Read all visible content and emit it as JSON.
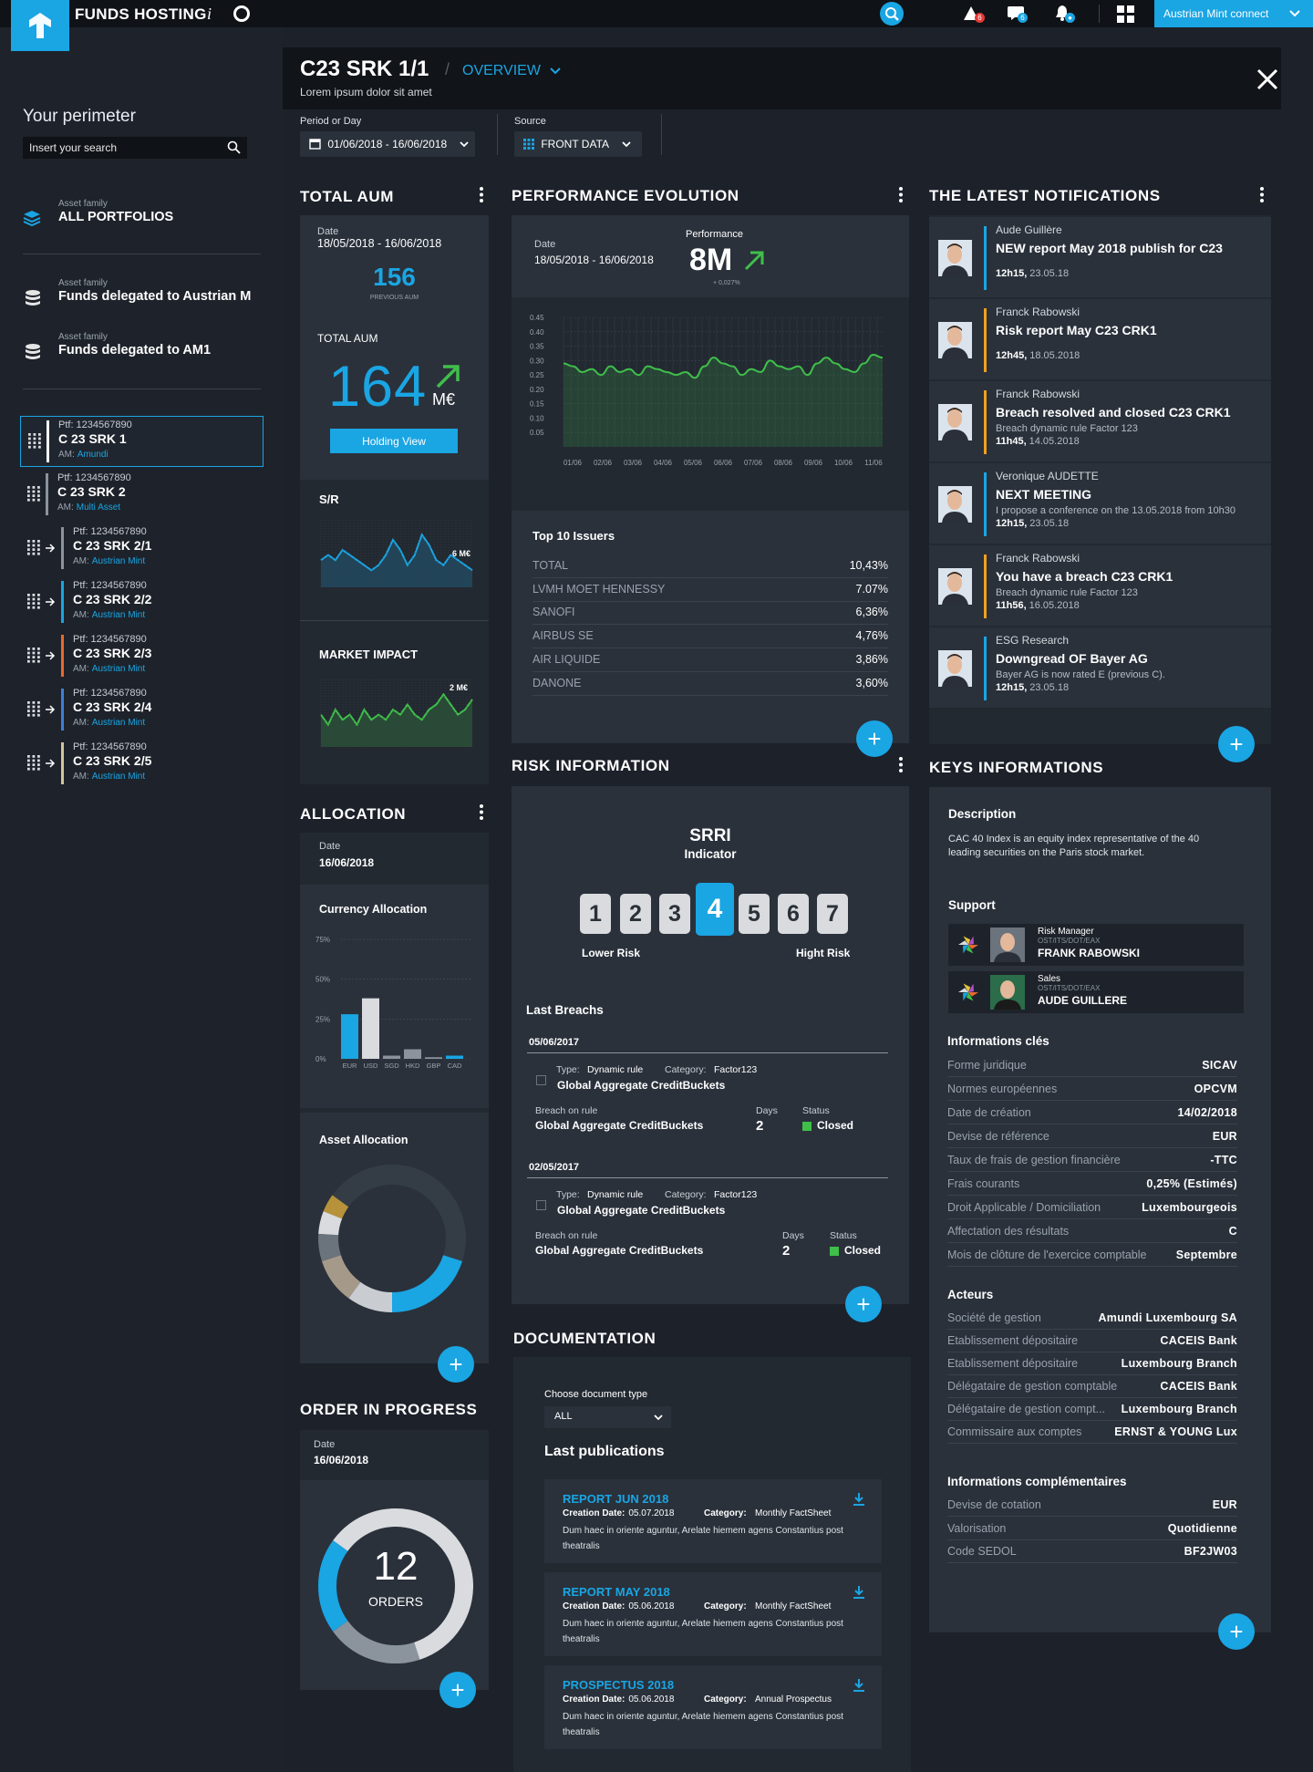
{
  "app": {
    "brand": "FUNDS HOSTING",
    "info": "i",
    "connect": "Austrian Mint connect",
    "alerts": {
      "warnings": "6",
      "messages": "6",
      "notifications": "●"
    }
  },
  "sidebar": {
    "title": "Your perimeter",
    "search_placeholder": "Insert your search",
    "families": [
      {
        "label": "Asset family",
        "value": "ALL PORTFOLIOS"
      },
      {
        "label": "Asset family",
        "value": "Funds delegated to Austrian M"
      },
      {
        "label": "Asset family",
        "value": "Funds delegated to AM1"
      }
    ],
    "portfolios": [
      {
        "ptf": "Ptf:  1234567890",
        "name": "C 23 SRK 1",
        "am_label": "AM:",
        "am": "Amundi",
        "color": "#ffffff"
      },
      {
        "ptf": "Ptf:  1234567890",
        "name": "C 23 SRK 2",
        "am_label": "AM:",
        "am": "Multi Asset",
        "color": "#8b939c"
      },
      {
        "ptf": "Ptf:  1234567890",
        "name": "C 23 SRK 2/1",
        "am_label": "AM:",
        "am": "Austrian Mint",
        "color": "#8b939c"
      },
      {
        "ptf": "Ptf:  1234567890",
        "name": "C 23 SRK 2/2",
        "am_label": "AM:",
        "am": "Austrian Mint",
        "color": "#1aa5e3"
      },
      {
        "ptf": "Ptf:  1234567890",
        "name": "C 23 SRK 2/3",
        "am_label": "AM:",
        "am": "Austrian Mint",
        "color": "#e8692c"
      },
      {
        "ptf": "Ptf:  1234567890",
        "name": "C 23 SRK 2/4",
        "am_label": "AM:",
        "am": "Austrian Mint",
        "color": "#3d7fd9"
      },
      {
        "ptf": "Ptf:  1234567890",
        "name": "C 23 SRK 2/5",
        "am_label": "AM:",
        "am": "Austrian Mint",
        "color": "#d6c49a"
      }
    ]
  },
  "header": {
    "title": "C23 SRK 1/1",
    "sep": "/",
    "view": "OVERVIEW",
    "subtitle": "Lorem ipsum dolor sit amet"
  },
  "filters": {
    "period_label": "Period or Day",
    "period": "01/06/2018 - 16/06/2018",
    "source_label": "Source",
    "source": "FRONT DATA"
  },
  "total_aum": {
    "title": "TOTAL AUM",
    "date_label": "Date",
    "date": "18/05/2018 - 16/06/2018",
    "previous": "156",
    "previous_label": "PREVIOUS AUM",
    "label": "TOTAL  AUM",
    "value": "164",
    "unit": "M€",
    "button": "Holding View",
    "sr_label": "S/R",
    "sr_value": "6 M€",
    "mi_label": "MARKET IMPACT",
    "mi_value": "2 M€"
  },
  "allocation": {
    "title": "ALLOCATION",
    "date_label": "Date",
    "date": "16/06/2018",
    "currency_title": "Currency Allocation",
    "asset_title": "Asset Allocation"
  },
  "orders": {
    "title": "ORDER IN PROGRESS",
    "date_label": "Date",
    "date": "16/06/2018",
    "count": "12",
    "count_label": "ORDERS"
  },
  "performance": {
    "title": "PERFORMANCE EVOLUTION",
    "date_label": "Date",
    "date": "18/05/2018 - 16/06/2018",
    "perf_label": "Performance",
    "value": "8M",
    "delta": "+ 0,027%",
    "issuers_title": "Top 10 Issuers",
    "issuers": [
      {
        "name": "TOTAL",
        "value": "10,43%"
      },
      {
        "name": "LVMH MOET HENNESSY",
        "value": "7.07%"
      },
      {
        "name": "SANOFI",
        "value": "6,36%"
      },
      {
        "name": "AIRBUS SE",
        "value": "4,76%"
      },
      {
        "name": "AIR LIQUIDE",
        "value": "3,86%"
      },
      {
        "name": "DANONE",
        "value": "3,60%"
      }
    ]
  },
  "risk": {
    "title": "RISK INFORMATION",
    "srri_title": "SRRI",
    "srri_sub": "Indicator",
    "levels": [
      "1",
      "2",
      "3",
      "4",
      "5",
      "6",
      "7"
    ],
    "current": 4,
    "low": "Lower Risk",
    "high": "Hight Risk",
    "breaches_title": "Last Breachs",
    "breaches": [
      {
        "date": "05/06/2017",
        "type_label": "Type:",
        "type": "Dynamic rule",
        "cat_label": "Category:",
        "cat": "Factor123",
        "name": "Global Aggregate CreditBuckets",
        "rule_label": "Breach on rule",
        "rule": "Global Aggregate CreditBuckets",
        "days_label": "Days",
        "days": "2",
        "status_label": "Status",
        "status": "Closed"
      },
      {
        "date": "02/05/2017",
        "type_label": "Type:",
        "type": "Dynamic rule",
        "cat_label": "Category:",
        "cat": "Factor123",
        "name": "Global Aggregate CreditBuckets",
        "rule_label": "Breach on rule",
        "rule": "Global Aggregate CreditBuckets",
        "days_label": "Days",
        "days": "2",
        "status_label": "Status",
        "status": "Closed"
      }
    ]
  },
  "documentation": {
    "title": "DOCUMENTATION",
    "choose_label": "Choose document type",
    "choose_value": "ALL",
    "last_title": "Last publications",
    "docs": [
      {
        "title": "REPORT JUN 2018",
        "date_label": "Creation Date:",
        "date": "05.07.2018",
        "cat_label": "Category:",
        "cat": "Monthly FactSheet",
        "desc": "Dum haec in oriente aguntur, Arelate hiemem agens Constantius post theatralis"
      },
      {
        "title": "REPORT MAY 2018",
        "date_label": "Creation Date:",
        "date": "05.06.2018",
        "cat_label": "Category:",
        "cat": "Monthly FactSheet",
        "desc": "Dum haec in oriente aguntur, Arelate hiemem agens Constantius post theatralis"
      },
      {
        "title": "PROSPECTUS 2018",
        "date_label": "Creation Date:",
        "date": "05.06.2018",
        "cat_label": "Category:",
        "cat": "Annual Prospectus",
        "desc": "Dum haec in oriente aguntur, Arelate hiemem agens Constantius post theatralis"
      }
    ]
  },
  "notifications": {
    "title": "THE LATEST NOTIFICATIONS",
    "items": [
      {
        "who": "Aude Guillère",
        "title": "NEW report May 2018 publish for C23",
        "sub": "",
        "time": "12h15,",
        "date": "23.05.18",
        "color": "#1aa5e3"
      },
      {
        "who": "Franck Rabowski",
        "title": "Risk report May C23 CRK1",
        "sub": "",
        "time": "12h45,",
        "date": "18.05.2018",
        "color": "#f0a020"
      },
      {
        "who": "Franck Rabowski",
        "title": "Breach resolved and closed C23 CRK1",
        "sub": "Breach dynamic rule Factor 123",
        "time": "11h45,",
        "date": "14.05.2018",
        "color": "#f0a020"
      },
      {
        "who": "Veronique AUDETTE",
        "title": "NEXT MEETING",
        "sub": "I propose a conference on the 13.05.2018 from 10h30",
        "time": "12h15,",
        "date": "23.05.18",
        "color": "#1aa5e3"
      },
      {
        "who": "Franck Rabowski",
        "title": "You have a breach C23 CRK1",
        "sub": "Breach dynamic rule Factor 123",
        "time": "11h56,",
        "date": "16.05.2018",
        "color": "#f0a020"
      },
      {
        "who": "ESG Research",
        "title": "Downgread OF Bayer AG",
        "sub": "Bayer AG is now rated E (previous C).",
        "time": "12h15,",
        "date": "23.05.18",
        "color": "#1aa5e3"
      }
    ]
  },
  "keys": {
    "title": "KEYS INFORMATIONS",
    "desc_title": "Description",
    "desc": "CAC 40 Index is an equity index representative of the 40 leading securities on the Paris stock market.",
    "support_title": "Support",
    "support": [
      {
        "role": "Risk Manager",
        "dept": "OST/ITS/DOT/EAX",
        "name": "FRANK RABOWSKI"
      },
      {
        "role": "Sales",
        "dept": "OST/ITS/DOT/EAX",
        "name": "AUDE GUILLERE"
      }
    ],
    "info_title": "Informations clés",
    "info": [
      {
        "k": "Forme juridique",
        "v": "SICAV"
      },
      {
        "k": "Normes européennes",
        "v": "OPCVM"
      },
      {
        "k": "Date de création",
        "v": "14/02/2018"
      },
      {
        "k": "Devise de référence",
        "v": "EUR"
      },
      {
        "k": "Taux de frais de gestion financière",
        "v": "-TTC"
      },
      {
        "k": "Frais courants",
        "v": "0,25% (Estimés)"
      },
      {
        "k": "Droit Applicable / Domiciliation",
        "v": "Luxembourgeois"
      },
      {
        "k": "Affectation des résultats",
        "v": "C"
      },
      {
        "k": "Mois de clôture de l'exercice comptable",
        "v": "Septembre"
      }
    ],
    "actors_title": "Acteurs",
    "actors": [
      {
        "k": "Société de gestion",
        "v": "Amundi Luxembourg SA"
      },
      {
        "k": "Etablissement dépositaire",
        "v": "CACEIS Bank"
      },
      {
        "k": "Etablissement dépositaire",
        "v": "Luxembourg Branch"
      },
      {
        "k": "Délégataire de gestion comptable",
        "v": "CACEIS Bank"
      },
      {
        "k": "Délégataire de gestion compt...",
        "v": "Luxembourg Branch"
      },
      {
        "k": "Commissaire aux comptes",
        "v": "ERNST & YOUNG Lux"
      }
    ],
    "extra_title": "Informations complémentaires",
    "extra": [
      {
        "k": "Devise de cotation",
        "v": "EUR"
      },
      {
        "k": "Valorisation",
        "v": "Quotidienne"
      },
      {
        "k": "Code SEDOL",
        "v": "BF2JW03"
      }
    ]
  },
  "chart_data": [
    {
      "type": "area",
      "name": "performance",
      "x": [
        "01/06",
        "02/06",
        "03/06",
        "04/06",
        "05/06",
        "06/06",
        "07/06",
        "08/06",
        "09/06",
        "10/06",
        "11/06"
      ],
      "y": [
        0.29,
        0.28,
        0.26,
        0.27,
        0.25,
        0.28,
        0.26,
        0.27,
        0.25,
        0.28,
        0.27,
        0.26,
        0.25,
        0.26,
        0.24,
        0.28,
        0.31,
        0.29,
        0.28,
        0.25,
        0.27,
        0.26,
        0.3,
        0.28,
        0.27,
        0.28,
        0.25,
        0.29,
        0.31,
        0.29,
        0.27,
        0.26,
        0.29,
        0.32,
        0.31
      ],
      "yticks": [
        "0.45",
        "0.40",
        "0.35",
        "0.30",
        "0.25",
        "0.20",
        "0.15",
        "0.10",
        "0.05"
      ],
      "ylim": [
        0,
        0.45
      ],
      "color": "#3fbf4a"
    },
    {
      "type": "bar",
      "name": "currency",
      "categories": [
        "EUR",
        "USD",
        "SGD",
        "HKD",
        "GBP",
        "CAD"
      ],
      "values": [
        28,
        38,
        2,
        6,
        1,
        2
      ],
      "yticks": [
        "75%",
        "50%",
        "25%",
        "0%"
      ],
      "ylim": [
        0,
        75
      ],
      "colors": [
        "#1aa5e3",
        "#d9dbde",
        "#8b939c",
        "#8b939c",
        "#8b939c",
        "#1aa5e3"
      ]
    },
    {
      "type": "pie",
      "name": "asset",
      "values": [
        30,
        20,
        10,
        10,
        6,
        5,
        4,
        15
      ],
      "colors": [
        "#343d46",
        "#1aa5e3",
        "#c9cdd2",
        "#a59a8a",
        "#6b737c",
        "#d9dbde",
        "#b8923a",
        "#343d46"
      ]
    },
    {
      "type": "pie",
      "name": "orders",
      "values": [
        45,
        20,
        20,
        15
      ],
      "colors": [
        "#d9dbde",
        "#8b939c",
        "#1aa5e3",
        "#d9dbde"
      ]
    },
    {
      "type": "area",
      "name": "sr",
      "y": [
        5,
        6,
        5,
        7,
        6,
        5,
        4,
        3,
        4,
        6,
        9,
        7,
        4,
        6,
        10,
        8,
        5,
        4,
        6,
        5,
        4,
        3
      ],
      "color": "#1aa5e3"
    },
    {
      "type": "area",
      "name": "market_impact",
      "y": [
        6,
        4,
        7,
        5,
        6,
        4,
        7,
        5,
        6,
        5,
        7,
        6,
        8,
        6,
        5,
        7,
        8,
        10,
        8,
        6,
        7,
        9
      ],
      "color": "#3fbf4a"
    }
  ]
}
